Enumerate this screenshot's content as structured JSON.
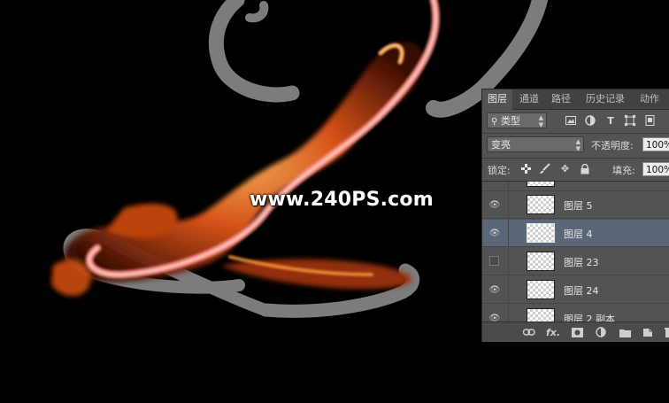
{
  "watermark": "www.240PS.com",
  "panel": {
    "tabs": [
      "图层",
      "通道",
      "路径",
      "历史记录",
      "动作"
    ],
    "active_tab": "图层",
    "filter_kind": "类型",
    "filter_icons": [
      "image-filter-icon",
      "adjustment-filter-icon",
      "text-filter-icon",
      "shape-filter-icon",
      "smart-object-filter-icon"
    ],
    "blend_mode": "变亮",
    "opacity_label": "不透明度:",
    "opacity_value": "100%",
    "lock_label": "锁定:",
    "fill_label": "填充:",
    "fill_value": "100%",
    "layers": [
      {
        "name": "",
        "visible": true,
        "selected": false
      },
      {
        "name": "图层 5",
        "visible": true,
        "selected": false
      },
      {
        "name": "图层 4",
        "visible": true,
        "selected": true
      },
      {
        "name": "图层 23",
        "visible": false,
        "selected": false
      },
      {
        "name": "图层 24",
        "visible": true,
        "selected": false
      },
      {
        "name": "图层 2 副本",
        "visible": true,
        "selected": false
      }
    ],
    "footer_icons": [
      "link-layers-icon",
      "fx-icon",
      "add-mask-icon",
      "adjustment-layer-icon",
      "new-group-icon",
      "new-layer-icon",
      "delete-layer-icon"
    ],
    "footer_fx_text": "fx."
  },
  "colors": {
    "background": "#000000",
    "panel": "#535353",
    "selected_row": "#5b6678",
    "stroke_gray": "#808080",
    "fire_orange": "#ff8a2a"
  }
}
